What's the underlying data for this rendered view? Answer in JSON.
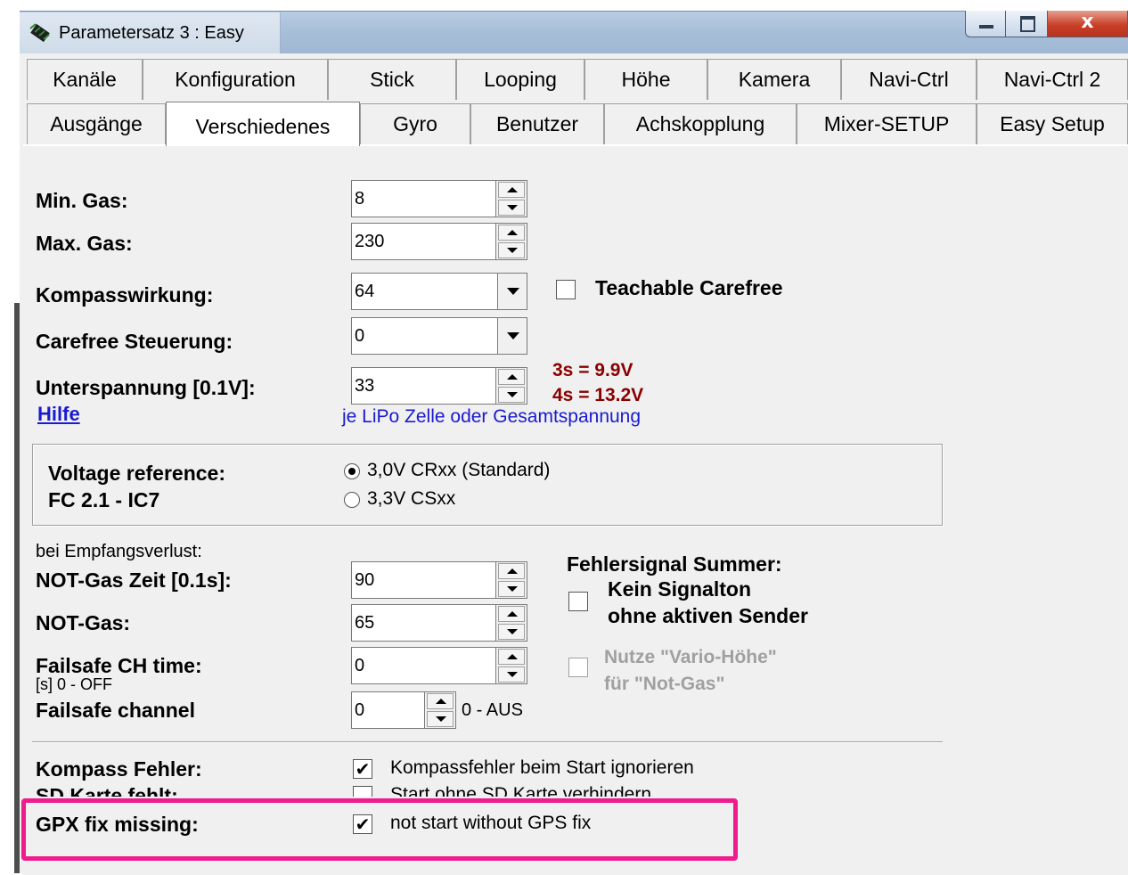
{
  "window": {
    "title": "Parametersatz 3 : Easy",
    "close_label": "x"
  },
  "tabs_row1": [
    "Kanäle",
    "Konfiguration",
    "Stick",
    "Looping",
    "Höhe",
    "Kamera",
    "Navi-Ctrl",
    "Navi-Ctrl 2"
  ],
  "tabs_row2": [
    "Ausgänge",
    "Verschiedenes",
    "Gyro",
    "Benutzer",
    "Achskopplung",
    "Mixer-SETUP",
    "Easy Setup"
  ],
  "active_tab": "Verschiedenes",
  "fields": {
    "min_gas": {
      "label": "Min. Gas:",
      "value": "8"
    },
    "max_gas": {
      "label": "Max. Gas:",
      "value": "230"
    },
    "kompass": {
      "label": "Kompasswirkung:",
      "value": "64"
    },
    "carefree": {
      "label": "Carefree Steuerung:",
      "value": "0"
    },
    "unterspannung": {
      "label": "Unterspannung [0.1V]:",
      "value": "33"
    },
    "hilfe": "Hilfe",
    "lipo_note": "je LiPo Zelle oder Gesamtspannung",
    "cell3": "3s = 9.9V",
    "cell4": "4s = 13.2V",
    "teachable": {
      "label": "Teachable Carefree",
      "checked": false
    }
  },
  "voltage_ref": {
    "label1": "Voltage reference:",
    "label2": "FC 2.1 - IC7",
    "opt1": "3,0V CRxx (Standard)",
    "opt2": "3,3V CSxx",
    "selected": "opt1"
  },
  "failsafe": {
    "section": "bei Empfangsverlust:",
    "notgas_zeit": {
      "label": "NOT-Gas Zeit [0.1s]:",
      "value": "90"
    },
    "notgas": {
      "label": "NOT-Gas:",
      "value": "65"
    },
    "ch_time": {
      "label": "Failsafe CH time:",
      "sub": "[s] 0 - OFF",
      "value": "0"
    },
    "channel": {
      "label": "Failsafe channel",
      "value": "0",
      "note": "0 - AUS"
    },
    "summer_title": "Fehlersignal Summer:",
    "summer_line1": "Kein Signalton",
    "summer_line2": "ohne aktiven Sender",
    "summer_checked": false,
    "vario_line1": "Nutze \"Vario-Höhe\"",
    "vario_line2": "für \"Not-Gas\"",
    "vario_checked": false
  },
  "bottom": {
    "kompass_fehler": {
      "label": "Kompass Fehler:",
      "text": "Kompassfehler beim Start ignorieren",
      "checked": true
    },
    "sd_karte": {
      "label": "SD Karte fehlt:",
      "text": "Start ohne SD Karte verhindern",
      "checked": false
    },
    "gpx": {
      "label": "GPX fix missing:",
      "text": "not start without GPS fix",
      "checked": true
    }
  },
  "colors": {
    "highlight": "#ee1c8c",
    "voltage_text": "#8b0000",
    "link": "#1a1ad0"
  }
}
